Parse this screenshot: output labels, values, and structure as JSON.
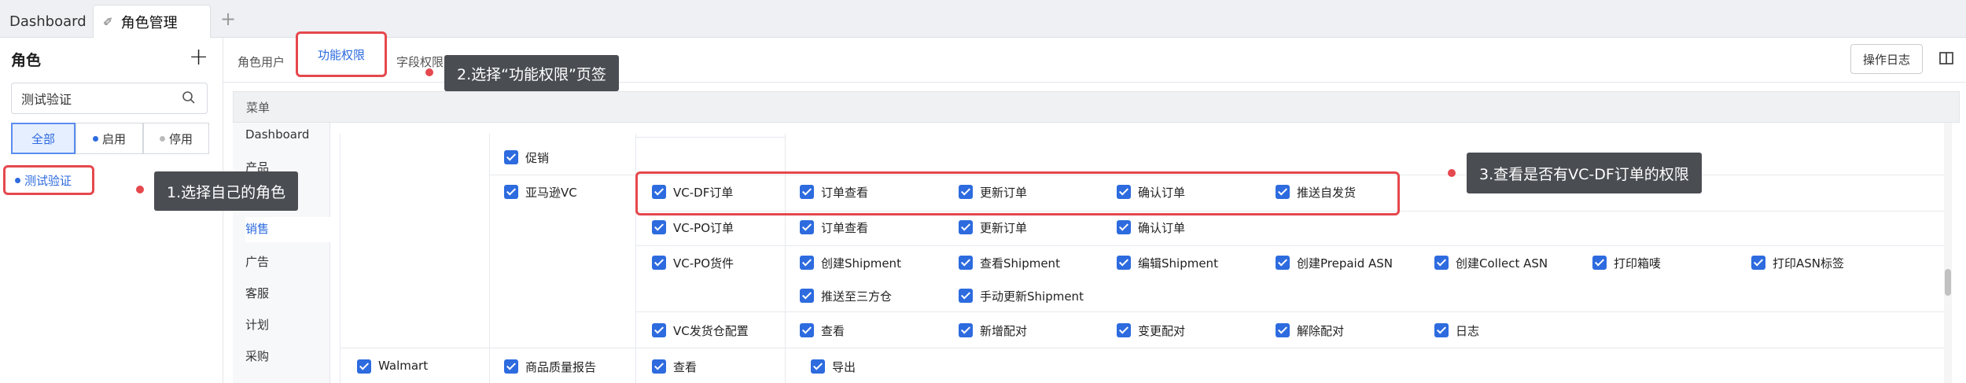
{
  "tabs": {
    "dashboard": "Dashboard",
    "role_mgmt": "角色管理",
    "add": "+"
  },
  "left": {
    "title": "角色",
    "add": "+",
    "search_value": "测试验证",
    "filters": {
      "all": "全部",
      "enabled": "启用",
      "disabled": "停用"
    },
    "roles": [
      "测试验证"
    ]
  },
  "callouts": {
    "c1": "1.选择自己的角色",
    "c2": "2.选择“功能权限”页签",
    "c3": "3.查看是否有VC-DF订单的权限"
  },
  "subtabs": {
    "users": "角色用户",
    "func": "功能权限",
    "field": "字段权限"
  },
  "log_button": "操作日志",
  "menu_header": "菜单",
  "menu_items": [
    "Dashboard",
    "产品",
    "销售",
    "广告",
    "客服",
    "计划",
    "采购"
  ],
  "menu_item_hidden": "销售",
  "permissions": {
    "promo": "促销",
    "amazon_vc": "亚马逊VC",
    "vcdf": "VC-DF订单",
    "vcdf_perms": [
      "订单查看",
      "更新订单",
      "确认订单",
      "推送自发货"
    ],
    "vcpo": "VC-PO订单",
    "vcpo_perms": [
      "订单查看",
      "更新订单",
      "确认订单"
    ],
    "vcpo_ship": "VC-PO货件",
    "vcpo_ship_perms": [
      "创建Shipment",
      "查看Shipment",
      "编辑Shipment",
      "创建Prepaid ASN",
      "创建Collect ASN",
      "打印箱唛",
      "打印ASN标签",
      "推送至三方仓",
      "手动更新Shipment"
    ],
    "vc_cfg": "VC发货仓配置",
    "vc_cfg_perms": [
      "查看",
      "新增配对",
      "变更配对",
      "解除配对",
      "日志"
    ],
    "walmart": "Walmart",
    "quality": "商品质量报告",
    "quality_perms": [
      "查看",
      "导出"
    ]
  },
  "accent": "#2d6bdf",
  "highlight": "#e5484d"
}
